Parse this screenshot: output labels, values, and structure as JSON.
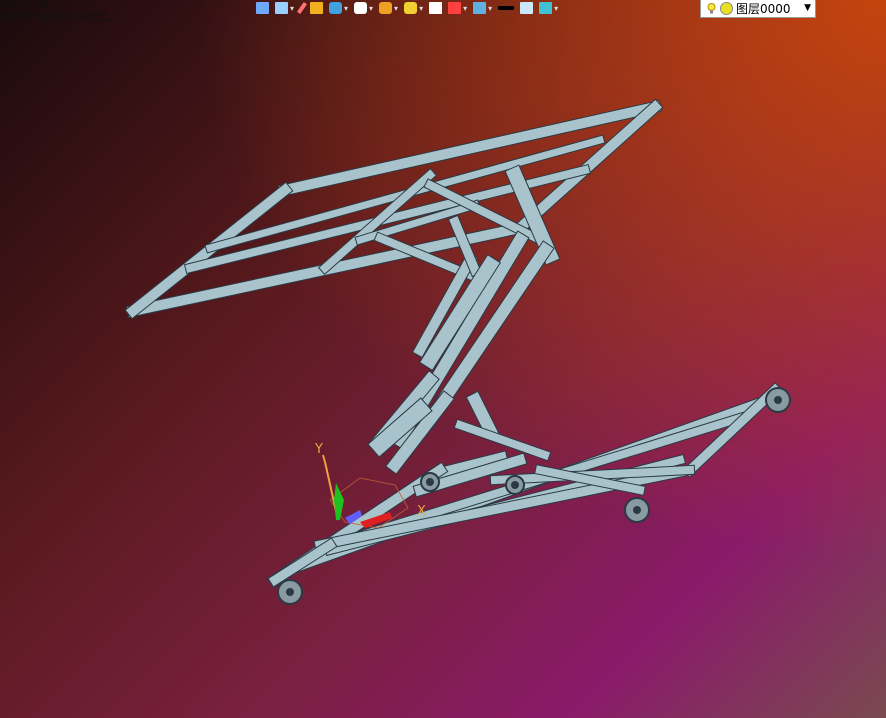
{
  "hints": {
    "line1": "选择对象",
    "line2": "拖动时请选择点提示。"
  },
  "toolbar": {
    "items": [
      {
        "icon": "exit-icon",
        "color": "#6fa8ff",
        "dropdown": false
      },
      {
        "icon": "view-orient-icon",
        "color": "#9ad0ff",
        "dropdown": true
      },
      {
        "icon": "pencil-icon",
        "color": "#ff7070",
        "dropdown": false
      },
      {
        "icon": "solid-shaded-icon",
        "color": "#f0b020",
        "dropdown": false
      },
      {
        "icon": "cube-shaded-icon",
        "color": "#40a0e0",
        "dropdown": true
      },
      {
        "icon": "cube-wire-icon",
        "color": "#ffffff",
        "dropdown": true
      },
      {
        "icon": "section-icon",
        "color": "#f0a020",
        "dropdown": true
      },
      {
        "icon": "zoom-icon",
        "color": "#f0d030",
        "dropdown": true
      },
      {
        "icon": "rotate-icon",
        "color": "#ffffff",
        "dropdown": false
      },
      {
        "icon": "frame-icon",
        "color": "#ff4040",
        "dropdown": true
      },
      {
        "icon": "display-icon",
        "color": "#60b0e0",
        "dropdown": true
      },
      {
        "icon": "line-color-icon",
        "color": "#000000",
        "dropdown": false
      },
      {
        "icon": "fill-color-icon",
        "color": "#cce8f8",
        "dropdown": false
      },
      {
        "icon": "layer-icon",
        "color": "#40c0d0",
        "dropdown": true
      }
    ]
  },
  "layer": {
    "value": "图层0000"
  },
  "axes": {
    "x_label": "X",
    "y_label": "Y",
    "x_color": "#e02020",
    "y_color": "#20c020",
    "z_color": "#6060ff",
    "label_color": "#f0a040"
  },
  "colors": {
    "frame": "#a9c3cc",
    "frame_dark": "#2a3a44",
    "wheel": "#8a9aa2"
  }
}
